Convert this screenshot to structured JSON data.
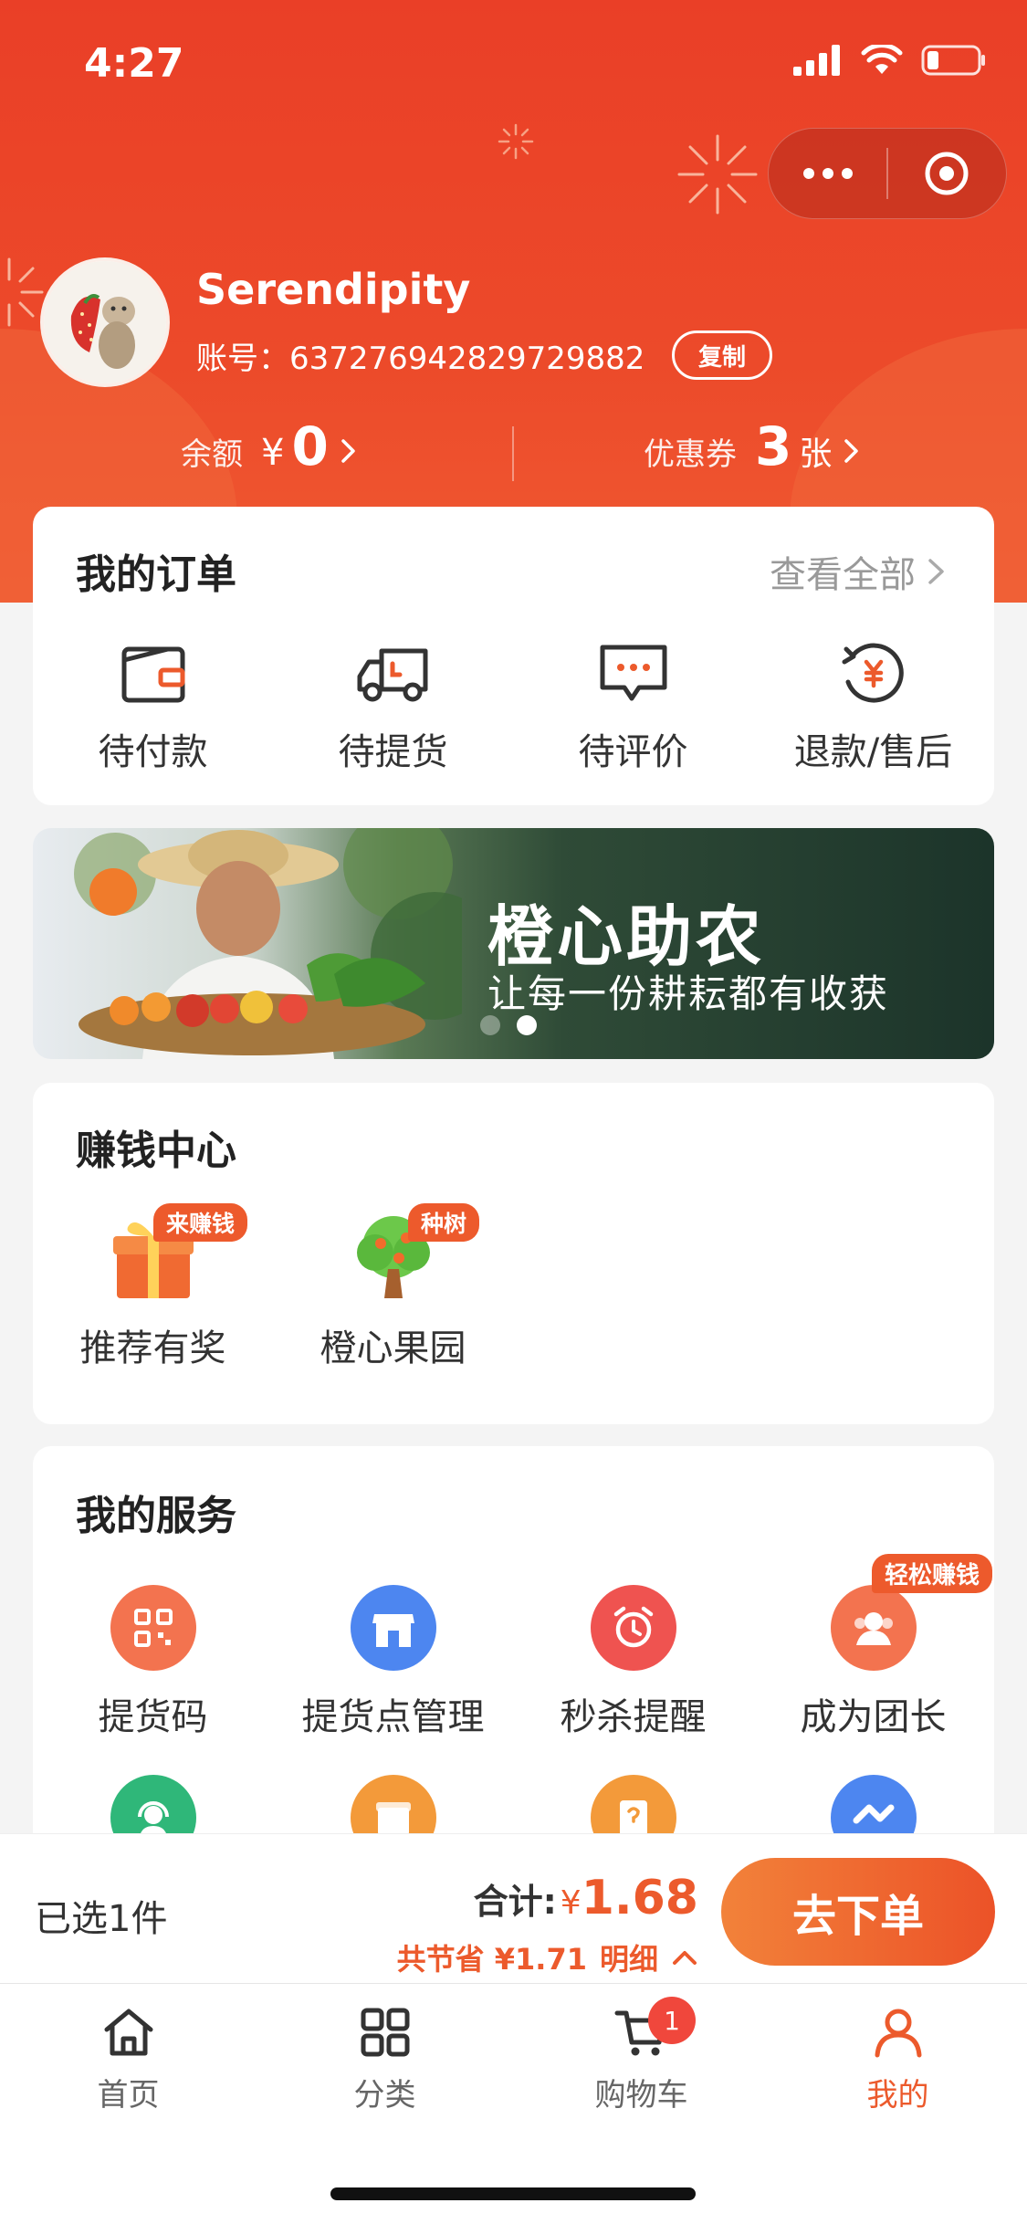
{
  "status_bar": {
    "time": "4:27"
  },
  "profile": {
    "username": "Serendipity",
    "account": "账号：637276942829729882",
    "copy_label": "复制"
  },
  "stats": {
    "balance_label": "余额",
    "balance_currency": "¥",
    "balance_value": "0",
    "coupon_label": "优惠券",
    "coupon_value": "3",
    "coupon_unit": "张"
  },
  "orders": {
    "title": "我的订单",
    "view_all": "查看全部",
    "items": [
      {
        "label": "待付款",
        "icon": "wallet-icon"
      },
      {
        "label": "待提货",
        "icon": "truck-icon"
      },
      {
        "label": "待评价",
        "icon": "comment-icon"
      },
      {
        "label": "退款/售后",
        "icon": "refund-icon"
      }
    ]
  },
  "banner": {
    "title": "橙心助农",
    "subtitle": "让每一份耕耘都有收获",
    "dot_count": 2,
    "active_dot": 1
  },
  "earn": {
    "title": "赚钱中心",
    "items": [
      {
        "label": "推荐有奖",
        "tag": "来赚钱",
        "icon": "gift-icon"
      },
      {
        "label": "橙心果园",
        "tag": "种树",
        "icon": "tree-icon"
      }
    ]
  },
  "services": {
    "title": "我的服务",
    "items": [
      {
        "label": "提货码",
        "icon": "qr-code-icon",
        "color": "#f3734f"
      },
      {
        "label": "提货点管理",
        "icon": "store-icon",
        "color": "#4d86f0"
      },
      {
        "label": "秒杀提醒",
        "icon": "alarm-clock-icon",
        "color": "#ef5350"
      },
      {
        "label": "成为团长",
        "icon": "leader-icon",
        "color": "#f3734f",
        "tag": "轻松赚钱"
      }
    ],
    "row2_icons": [
      {
        "icon": "customer-service-icon",
        "color": "#2fb779"
      },
      {
        "icon": "package-icon",
        "color": "#f39a3a"
      },
      {
        "icon": "document-icon",
        "color": "#f39a3a"
      },
      {
        "icon": "handshake-icon",
        "color": "#4d86f0"
      }
    ]
  },
  "checkout": {
    "selected": "已选1件",
    "total_label": "合计:",
    "currency": "¥",
    "total": "1.68",
    "savings": "共节省 ¥1.71",
    "detail": "明细",
    "order_button": "去下单"
  },
  "tabs": [
    {
      "label": "首页",
      "icon": "home-icon"
    },
    {
      "label": "分类",
      "icon": "category-icon"
    },
    {
      "label": "购物车",
      "icon": "cart-icon",
      "badge": "1"
    },
    {
      "label": "我的",
      "icon": "user-icon",
      "active": true
    }
  ],
  "colors": {
    "brand": "#ea3f27",
    "accent": "#ec5a2c",
    "badge": "#f0473c"
  }
}
